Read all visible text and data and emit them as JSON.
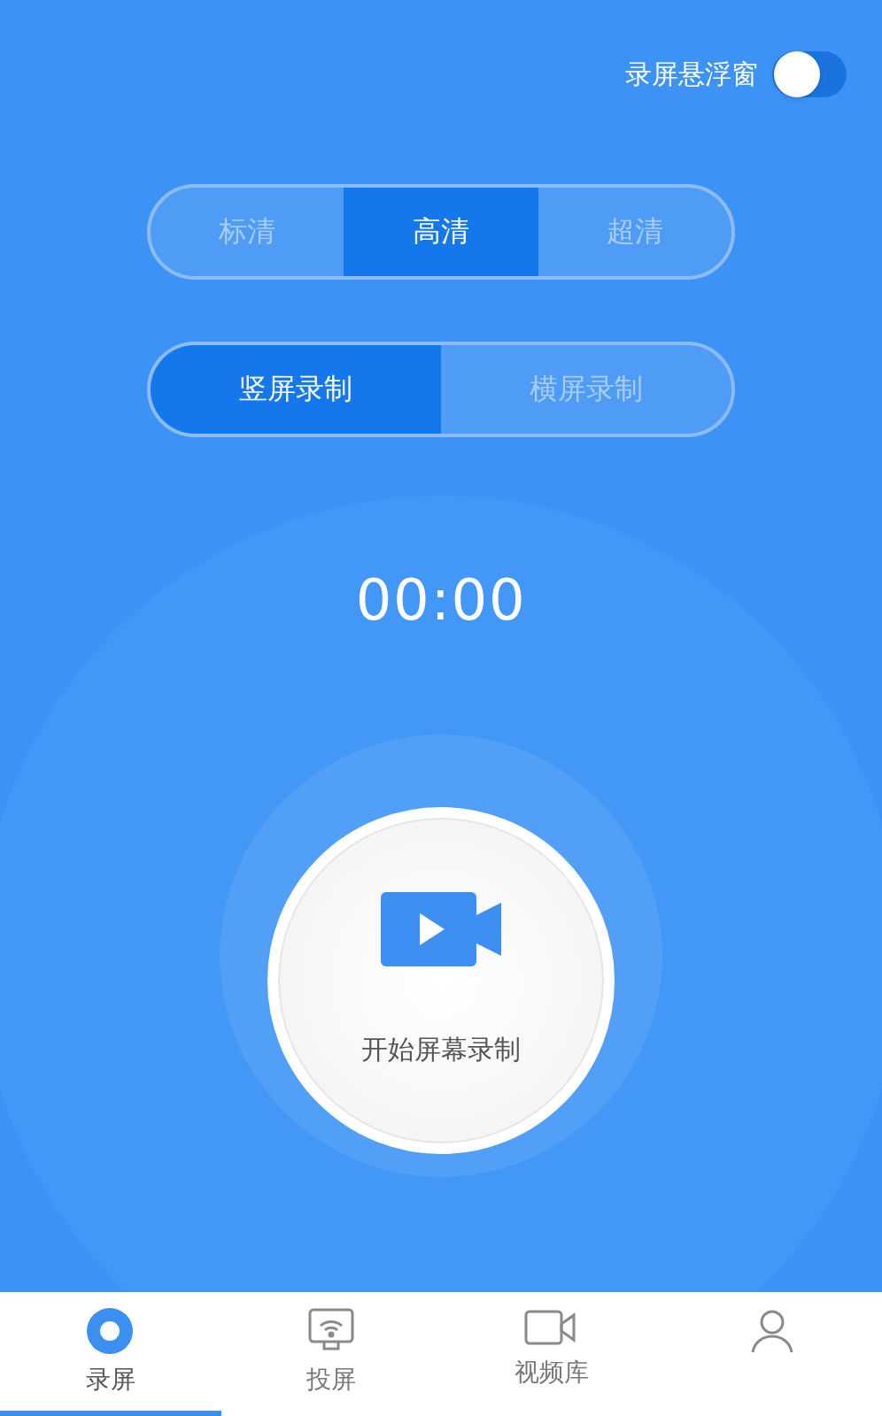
{
  "floating_window": {
    "label": "录屏悬浮窗",
    "on": false
  },
  "quality_options": [
    {
      "label": "标清",
      "selected": false
    },
    {
      "label": "高清",
      "selected": true
    },
    {
      "label": "超清",
      "selected": false
    }
  ],
  "orientation_options": [
    {
      "label": "竖屏录制",
      "selected": true
    },
    {
      "label": "横屏录制",
      "selected": false
    }
  ],
  "timer": "00:00",
  "record_button": {
    "label": "开始屏幕录制"
  },
  "tab_bar": [
    {
      "kind": "record",
      "label": "录屏",
      "selected": true
    },
    {
      "kind": "cast",
      "label": "投屏",
      "selected": false
    },
    {
      "kind": "videos",
      "label": "视频库",
      "selected": false
    },
    {
      "kind": "profile",
      "selected": false
    }
  ]
}
